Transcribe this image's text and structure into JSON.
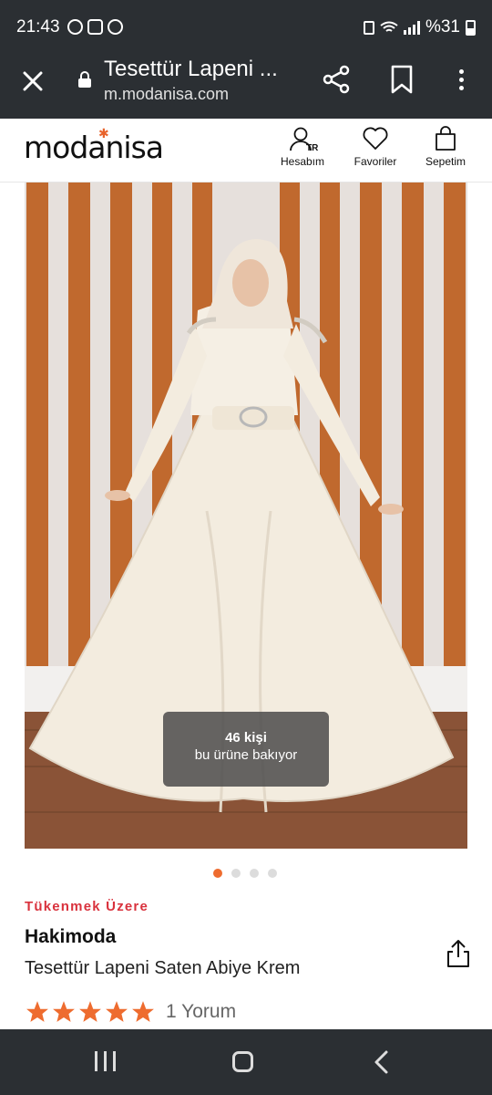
{
  "status_bar": {
    "time": "21:43",
    "battery": "%31"
  },
  "browser": {
    "title": "Tesettür Lapeni ...",
    "url": "m.modanisa.com"
  },
  "header": {
    "logo": "modanisa",
    "account_label": "Hesabım",
    "account_region": "TR",
    "favorites_label": "Favoriler",
    "cart_label": "Sepetim"
  },
  "product": {
    "viewers_count": "46 kişi",
    "viewers_text": "bu ürüne bakıyor",
    "image_count": 4,
    "active_image_index": 0,
    "stock_badge": "Tükenmek Üzere",
    "brand": "Hakimoda",
    "title": "Tesettür Lapeni Saten Abiye Krem",
    "rating": 5,
    "review_count": "1 Yorum"
  },
  "colors": {
    "accent": "#ee6c2f",
    "stock_badge": "#d9323d",
    "star": "#ee6c2f",
    "system_bar": "#2b2f33"
  }
}
